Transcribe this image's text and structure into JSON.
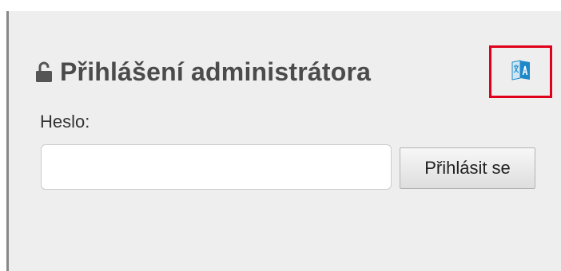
{
  "login_panel": {
    "title": "Přihlášení administrátora",
    "password_label": "Heslo:",
    "password_value": "",
    "submit_label": "Přihlásit se"
  },
  "icons": {
    "title_icon": "unlocked-padlock-icon",
    "language_icon": "translate-icon"
  },
  "colors": {
    "highlight_border": "#e0001b",
    "panel_background": "#eeeeee",
    "translate_icon_blue": "#1e88c8"
  }
}
